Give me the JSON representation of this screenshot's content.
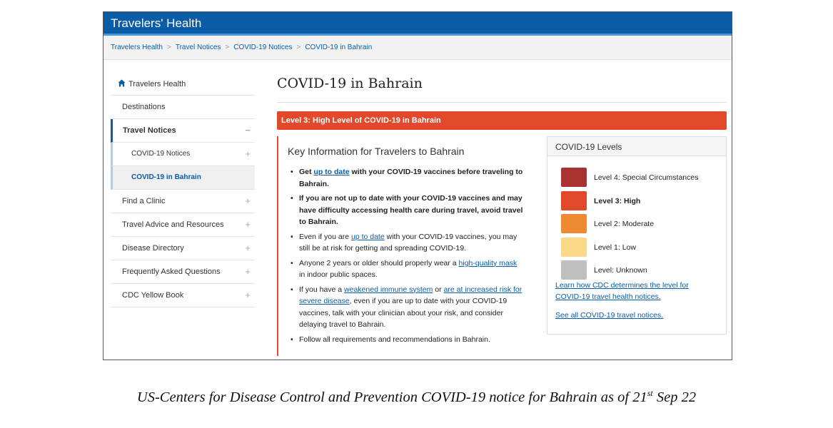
{
  "app": {
    "title": "Travelers' Health"
  },
  "breadcrumb": [
    "Travelers Health",
    "Travel Notices",
    "COVID-19 Notices",
    "COVID-19 in Bahrain"
  ],
  "sidebar": {
    "home": "Travelers Health",
    "items": [
      {
        "label": "Destinations",
        "control": ""
      },
      {
        "label": "Travel Notices",
        "control": "−"
      },
      {
        "label": "COVID-19 Notices",
        "control": "+"
      },
      {
        "label": "COVID-19 in Bahrain",
        "control": ""
      },
      {
        "label": "Find a Clinic",
        "control": "+"
      },
      {
        "label": "Travel Advice and Resources",
        "control": "+"
      },
      {
        "label": "Disease Directory",
        "control": "+"
      },
      {
        "label": "Frequently Asked Questions",
        "control": "+"
      },
      {
        "label": "CDC Yellow Book",
        "control": "+"
      }
    ]
  },
  "main": {
    "title": "COVID-19 in Bahrain",
    "banner": "Level 3: High Level of COVID-19 in Bahrain",
    "key_title": "Key Information for Travelers to Bahrain",
    "bullets": [
      {
        "a": "Get ",
        "link": "up to date",
        "b": " with your COVID-19 vaccines before traveling to Bahrain."
      },
      {
        "a": "If you are not up to date with your COVID-19 vaccines and may have difficulty accessing health care during travel, avoid travel to Bahrain."
      },
      {
        "a": "Even if you are ",
        "link": "up to date",
        "b": " with your COVID-19 vaccines, you may still be at risk for getting and spreading COVID-19."
      },
      {
        "a": "Anyone 2 years or older should properly wear a ",
        "link": "high-quality mask",
        "b": " in indoor public spaces."
      },
      {
        "a": "If you have a ",
        "link1": "weakened immune system",
        "mid": " or ",
        "link2": "are at increased risk for severe disease",
        "b": ", even if you are up to date with your COVID-19 vaccines, talk with your clinician about your risk, and consider delaying travel to Bahrain."
      },
      {
        "a": "Follow all requirements and recommendations in Bahrain."
      }
    ]
  },
  "levels": {
    "title": "COVID-19 Levels",
    "items": [
      {
        "label": "Level 4: Special Circumstances",
        "color": "#a83232"
      },
      {
        "label": "Level 3: High",
        "color": "#e2492a"
      },
      {
        "label": "Level 2: Moderate",
        "color": "#ee8a31"
      },
      {
        "label": "Level 1: Low",
        "color": "#fcd98a"
      },
      {
        "label": "Level: Unknown",
        "color": "#c0c0c0"
      }
    ],
    "link1": "Learn how CDC determines the level for COVID-19 travel health notices.",
    "link2": "See all COVID-19 travel notices."
  },
  "caption": {
    "text": "US-Centers for Disease Control and Prevention COVID-19 notice for Bahrain as of 21",
    "sup": "st",
    "tail": " Sep 22"
  },
  "colors": {
    "brand": "#0b5ca6",
    "alert": "#e2492a"
  }
}
